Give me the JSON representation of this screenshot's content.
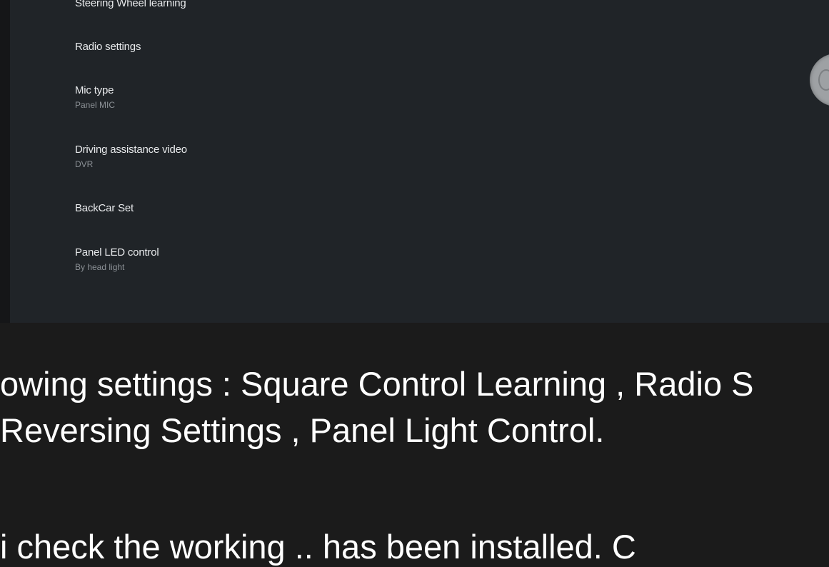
{
  "settings_list": [
    {
      "label": "Steering Wheel learning",
      "value": ""
    },
    {
      "label": "Radio settings",
      "value": ""
    },
    {
      "label": "Mic type",
      "value": "Panel MIC"
    },
    {
      "label": "Driving assistance video",
      "value": "DVR"
    },
    {
      "label": "BackCar Set",
      "value": ""
    },
    {
      "label": "Panel LED control",
      "value": "By head light"
    }
  ],
  "caption": {
    "line1": "owing settings : Square Control Learning , Radio S",
    "line2": "Reversing Settings , Panel Light Control.",
    "line3": "i   check the working   ..  has been installed. C"
  },
  "colors": {
    "page_background": "#1b1b1b",
    "screen_background": "#202428",
    "label_text": "#e8eaec",
    "value_text": "#8c9196",
    "caption_text": "#ffffff"
  }
}
